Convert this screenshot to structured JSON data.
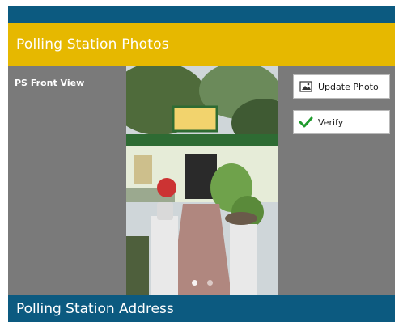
{
  "header": {
    "title": "Polling Station Photos"
  },
  "photo_section": {
    "label": "PS Front View",
    "carousel": {
      "total_pages": 2,
      "current_page": 1
    }
  },
  "actions": {
    "update_photo_label": "Update Photo",
    "verify_label": "Verify"
  },
  "footer": {
    "title": "Polling Station Address"
  },
  "colors": {
    "primary_blue": "#0c5a80",
    "header_yellow": "#e6b800",
    "panel_gray": "#7a7a7a",
    "verify_green": "#1f9b2d"
  },
  "icons": {
    "update_photo": "image-edit-icon",
    "verify": "checkmark-icon"
  }
}
